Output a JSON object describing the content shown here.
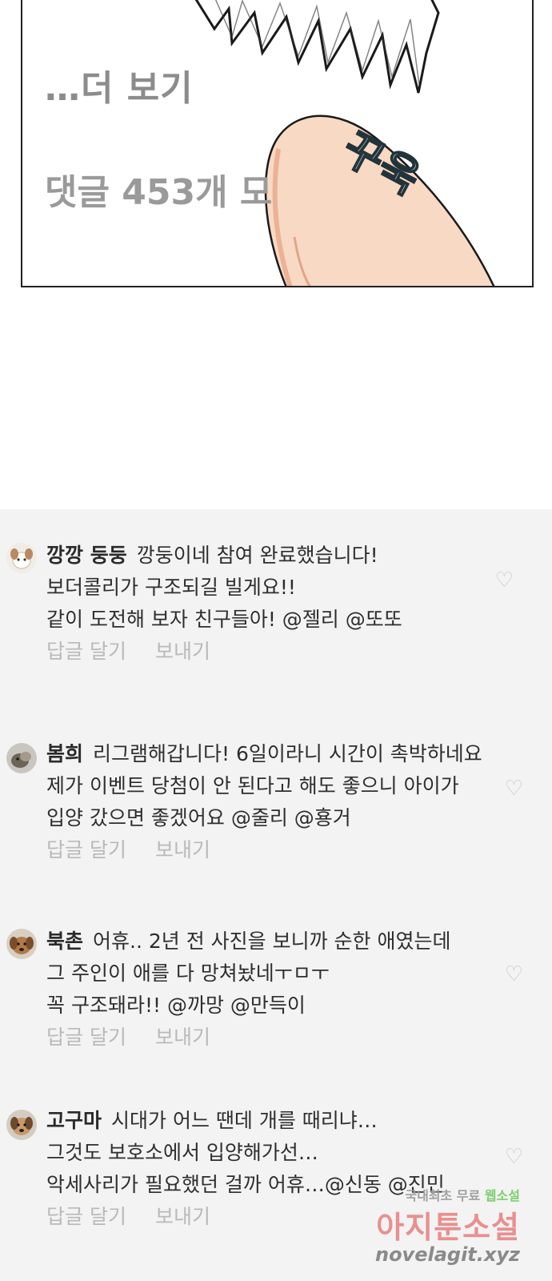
{
  "panel": {
    "see_more": "…더 보기",
    "comment_count": "댓글 453개 모",
    "sfx": "꾸욱"
  },
  "comments": [
    {
      "author": "깡깡 둥둥",
      "lines": [
        "깡둥이네 참여 완료했습니다!",
        "보더콜리가 구조되길 빌게요!!",
        "같이 도전해 보자 친구들아! @젤리 @또또"
      ],
      "reply_label": "답글 달기",
      "send_label": "보내기",
      "heart": "♡"
    },
    {
      "author": "봄희",
      "lines": [
        "리그램해갑니다! 6일이라니 시간이 촉박하네요",
        "제가 이벤트 당첨이 안 된다고 해도 좋으니 아이가",
        "입양 갔으면 좋겠어요 @줄리 @횽거"
      ],
      "reply_label": "답글 달기",
      "send_label": "보내기",
      "heart": "♡"
    },
    {
      "author": "북촌",
      "lines": [
        "어휴.. 2년 전 사진을 보니까 순한 애였는데",
        "그 주인이 애를 다 망쳐놨네ㅜㅁㅜ",
        "꼭 구조돼라!! @까망 @만득이"
      ],
      "reply_label": "답글 달기",
      "send_label": "보내기",
      "heart": "♡"
    },
    {
      "author": "고구마",
      "lines": [
        "시대가 어느 땐데 개를 때리냐…",
        "그것도 보호소에서 입양해가선…",
        "악세사리가 필요했던 걸까 어휴…@신동 @진민"
      ],
      "reply_label": "답글 달기",
      "send_label": "보내기",
      "heart": "♡"
    }
  ],
  "watermark": {
    "top_gray": "국내최초 무료",
    "top_green": "웹소설",
    "main": "아지툰소설",
    "url": "novelagit.xyz"
  }
}
